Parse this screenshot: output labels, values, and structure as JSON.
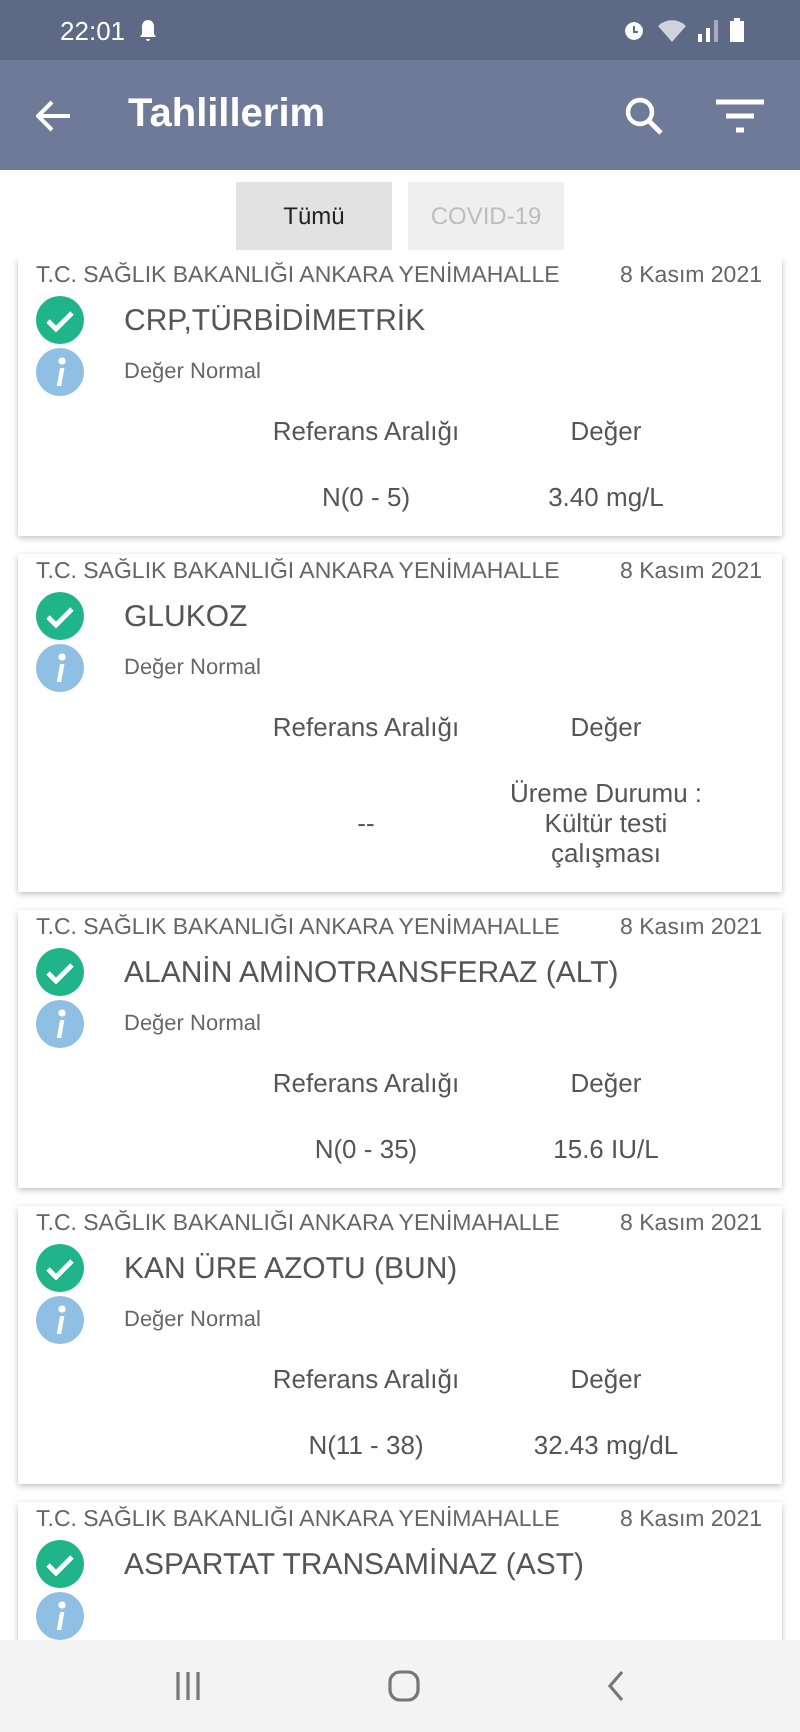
{
  "status_bar": {
    "time": "22:01"
  },
  "app_bar": {
    "title": "Tahlillerim"
  },
  "tabs": [
    {
      "label": "Tümü",
      "selected": true
    },
    {
      "label": "COVID-19",
      "selected": false
    }
  ],
  "results": [
    {
      "hospital": "T.C. SAĞLIK BAKANLIĞI ANKARA YENİMAHALLE",
      "date": "8 Kasım 2021",
      "test": "CRP,TÜRBİDİMETRİK",
      "note": "Değer Normal",
      "range_label": "Referans Aralığı",
      "value_label": "Değer",
      "range": "N(0 - 5)",
      "value": "3.40 mg/L"
    },
    {
      "hospital": "T.C. SAĞLIK BAKANLIĞI ANKARA YENİMAHALLE",
      "date": "8 Kasım 2021",
      "test": "GLUKOZ",
      "note": "Değer Normal",
      "range_label": "Referans Aralığı",
      "value_label": "Değer",
      "range": "--",
      "value": "Üreme Durumu : Kültür testi çalışması"
    },
    {
      "hospital": "T.C. SAĞLIK BAKANLIĞI ANKARA YENİMAHALLE",
      "date": "8 Kasım 2021",
      "test": "ALANİN AMİNOTRANSFERAZ (ALT)",
      "note": "Değer Normal",
      "range_label": "Referans Aralığı",
      "value_label": "Değer",
      "range": "N(0 - 35)",
      "value": "15.6 IU/L"
    },
    {
      "hospital": "T.C. SAĞLIK BAKANLIĞI ANKARA YENİMAHALLE",
      "date": "8 Kasım 2021",
      "test": "KAN ÜRE AZOTU (BUN)",
      "note": "Değer Normal",
      "range_label": "Referans Aralığı",
      "value_label": "Değer",
      "range": "N(11 - 38)",
      "value": "32.43 mg/dL"
    },
    {
      "hospital": "T.C. SAĞLIK BAKANLIĞI ANKARA YENİMAHALLE",
      "date": "8 Kasım 2021",
      "test": "ASPARTAT TRANSAMİNAZ (AST)"
    }
  ]
}
